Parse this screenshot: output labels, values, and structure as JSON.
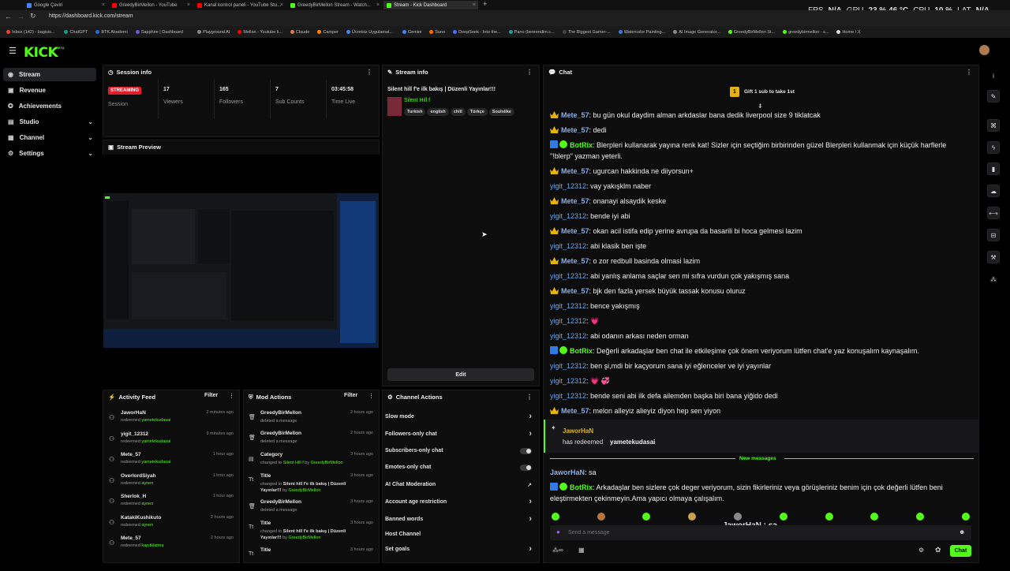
{
  "browser": {
    "tabs": [
      {
        "label": "Google Çeviri",
        "color": "#4285f4"
      },
      {
        "label": "GreedyBirMellon - YouTube",
        "color": "#ff0000"
      },
      {
        "label": "Kanal kontrol paneli - YouTube Stu...",
        "color": "#ff0000"
      },
      {
        "label": "GreedyBirMellon Stream - Watch...",
        "color": "#53fc18"
      },
      {
        "label": "Stream - Kick Dashboard",
        "color": "#53fc18"
      }
    ],
    "new_tab": "+",
    "url": "https://dashboard.kick.com/stream",
    "bookmarks": [
      "Inbox (142) - bagisis...",
      "ChatGPT",
      "BTK Akademi",
      "Sapphire | Dashboard",
      "Playground AI",
      "Mellon - Youtube li...",
      "Claude",
      "Camper",
      "Ücretsiz Uygulamal...",
      "Gemini",
      "Suno",
      "DeepSeek - Into the...",
      "Pano (benrendim.c...",
      "The Biggest Gamer-...",
      "Watercolor Painting...",
      "AI Image Generator...",
      "GreedyBirMellon St...",
      "greedybirmellon - s...",
      "Home / X"
    ]
  },
  "perf": {
    "fps_label": "FPS",
    "fps": "N/A",
    "gpu_label": "GPU",
    "gpu": "23 % 46 °C",
    "cpu_label": "CPU",
    "cpu": "10 %",
    "lat_label": "LAT",
    "lat": "N/A"
  },
  "logo": "KICK",
  "logo_badge": "BETA",
  "sidebar": {
    "items": [
      {
        "label": "Stream",
        "icon": "stream-icon",
        "active": true
      },
      {
        "label": "Revenue",
        "icon": "revenue-icon"
      },
      {
        "label": "Achievements",
        "icon": "achievements-icon"
      },
      {
        "label": "Studio",
        "icon": "studio-icon",
        "chev": "⌄"
      },
      {
        "label": "Channel",
        "icon": "channel-icon",
        "chev": "⌄"
      },
      {
        "label": "Settings",
        "icon": "gear-icon",
        "chev": "⌄"
      }
    ]
  },
  "session": {
    "title": "Session info",
    "badge": "STREAMING",
    "badge_label": "Session",
    "stats": [
      {
        "v": "17",
        "k": "Viewers"
      },
      {
        "v": "165",
        "k": "Followers"
      },
      {
        "v": "7",
        "k": "Sub Counts"
      },
      {
        "v": "03:45:58",
        "k": "Time Live"
      }
    ]
  },
  "preview": {
    "title": "Stream Preview"
  },
  "streaminfo": {
    "title": "Stream info",
    "stream_title": "Silent hill f'e ilk bakış | Düzenli Yayınlar!!!",
    "category": "Silent Hill f",
    "tags": [
      "Turkish",
      "english",
      "chill",
      "Türkçe",
      "Soulslike"
    ],
    "edit": "Edit"
  },
  "activity": {
    "title": "Activity Feed",
    "filter": "Filter",
    "items": [
      {
        "n": "JaworHaN",
        "s": "redeemed",
        "g": "yametekudasai",
        "t": "2 minutes ago"
      },
      {
        "n": "yigit_12312",
        "s": "redeemed",
        "g": "yametekudasai",
        "t": "9 minutes ago"
      },
      {
        "n": "Mete_57",
        "s": "redeemed",
        "g": "yametekudasai",
        "t": "1 hour ago"
      },
      {
        "n": "OverlordSiyah",
        "s": "redeemed",
        "g": "aynen",
        "t": "1 hour ago"
      },
      {
        "n": "Sherlok_H",
        "s": "redeemed",
        "g": "aynen",
        "t": "1 hour ago"
      },
      {
        "n": "KatakiKushikuto",
        "s": "redeemed",
        "g": "aynen",
        "t": "2 hours ago"
      },
      {
        "n": "Mete_57",
        "s": "redeemed",
        "g": "kapıtklatma",
        "t": "2 hours ago"
      }
    ]
  },
  "mod": {
    "title": "Mod Actions",
    "filter": "Filter",
    "items": [
      {
        "n": "GreedyBirMellon",
        "s": "deleted a message",
        "t": "2 hours ago"
      },
      {
        "n": "GreedyBirMellon",
        "s": "deleted a message",
        "t": "2 hours ago"
      },
      {
        "n": "Category",
        "s": "changed to",
        "g": "Silent Hill f",
        "s2": "by",
        "g2": "GreedyBirMellon",
        "t": "3 hours ago"
      },
      {
        "n": "Title",
        "s": "changed to",
        "w": "Silent hill f'e ilk bakış | Düzenli Yayınlar!!!",
        "s2": "by",
        "g2": "GreedyBirMellon",
        "t": "3 hours ago"
      },
      {
        "n": "GreedyBirMellon",
        "s": "deleted a message",
        "t": "3 hours ago"
      },
      {
        "n": "Title",
        "s": "changed to",
        "w": "Silent hill f'e ilk bakış | Düzenli Yayınlar!!!",
        "s2": "by",
        "g2": "GreedyBirMellon",
        "t": "3 hours ago"
      },
      {
        "n": "Title",
        "s": "",
        "t": "3 hours ago"
      }
    ]
  },
  "channel": {
    "title": "Channel Actions",
    "items": [
      {
        "label": "Slow mode",
        "ctrl": "chev"
      },
      {
        "label": "Followers-only chat",
        "ctrl": "chev"
      },
      {
        "label": "Subscribers-only chat",
        "ctrl": "toggle"
      },
      {
        "label": "Emotes-only chat",
        "ctrl": "toggle"
      },
      {
        "label": "AI Chat Moderation",
        "ctrl": "ext"
      },
      {
        "label": "Account age restriction",
        "ctrl": "chev"
      },
      {
        "label": "Banned words",
        "ctrl": "chev"
      },
      {
        "label": "Host Channel",
        "ctrl": ""
      },
      {
        "label": "Set goals",
        "ctrl": "chev"
      }
    ]
  },
  "chat": {
    "title": "Chat",
    "gift": "Gift 1 sub to take 1st",
    "gift_rank": "1",
    "messages": [
      {
        "u": "Mete_57",
        "cls": "u1",
        "b": "crown",
        "m": "bu gün okul daydim alman arkdaslar bana dedik liverpool size 9 tiklatcak"
      },
      {
        "u": "Mete_57",
        "cls": "u1",
        "b": "crown",
        "m": "dedi"
      },
      {
        "u": "BotRix",
        "cls": "u3",
        "b": "bot",
        "m": "Blerpleri kullanarak yayına renk kat! Sizler için seçtiğim birbirinden güzel Blerpleri kullanmak için küçük harflerle \"!blerp\" yazman yeterli."
      },
      {
        "u": "Mete_57",
        "cls": "u1",
        "b": "crown",
        "m": "ugurcan hakkinda ne diiyorsun+"
      },
      {
        "u": "yigit_12312",
        "cls": "u2",
        "b": "",
        "m": "vay yakışklm naber"
      },
      {
        "u": "Mete_57",
        "cls": "u1",
        "b": "crown",
        "m": "onanayi alsaydik keske"
      },
      {
        "u": "yigit_12312",
        "cls": "u2",
        "b": "",
        "m": "bende iyi abi"
      },
      {
        "u": "Mete_57",
        "cls": "u1",
        "b": "crown",
        "m": "okan acil istifa edip yerine avrupa da basarili bi hoca gelmesi lazim"
      },
      {
        "u": "yigit_12312",
        "cls": "u2",
        "b": "",
        "m": "abi klasik ben işte"
      },
      {
        "u": "Mete_57",
        "cls": "u1",
        "b": "crown",
        "m": "o zor redbull basinda olmasi lazim"
      },
      {
        "u": "yigit_12312",
        "cls": "u2",
        "b": "",
        "m": "abi yanlış anlama saçlar sen mi sıfra vurdun çok yakışmış sana"
      },
      {
        "u": "Mete_57",
        "cls": "u1",
        "b": "crown",
        "m": "bjk den fazla yersek büyük tassak konusu oluruz"
      },
      {
        "u": "yigit_12312",
        "cls": "u2",
        "b": "",
        "m": "bence yakışmış"
      },
      {
        "u": "yigit_12312",
        "cls": "u2",
        "b": "",
        "m": "💗"
      },
      {
        "u": "yigit_12312",
        "cls": "u2",
        "b": "",
        "m": "abi odanın arkası neden orman"
      },
      {
        "u": "BotRix",
        "cls": "u3",
        "b": "bot",
        "m": "Değerli arkadaşlar ben chat ile etkileşime çok önem veriyorum lütfen chat'e yaz konuşalım kaynaşalım."
      },
      {
        "u": "yigit_12312",
        "cls": "u2",
        "b": "",
        "m": "ben şi,mdi bir kaçyorum sana iyi eğlenceler ve iyi yayınlar"
      },
      {
        "u": "yigit_12312",
        "cls": "u2",
        "b": "",
        "m": "💗 💞"
      },
      {
        "u": "yigit_12312",
        "cls": "u2",
        "b": "",
        "m": "bende seni abi ilk defa ailemden başka biri bana yiğido dedi"
      },
      {
        "u": "Mete_57",
        "cls": "u1",
        "b": "crown",
        "m": "melon alleyiz alieyiz diyon hep sen yiyon"
      }
    ],
    "redeem": {
      "user": "JaworHaN",
      "text": "has redeemed",
      "gift": "yametekudasai"
    },
    "new_messages": "New messages",
    "after": [
      {
        "u": "JaworHaN",
        "cls": "u1",
        "b": "",
        "m": "sa"
      },
      {
        "u": "BotRix",
        "cls": "u3",
        "b": "bot",
        "m": "Arkadaşlar ben sizlere çok deger veriyorum, sizin fikirleriniz veya görüşleriniz benim için çok değerli lütfen beni eleştirmekten çekinmeyin.Ama yapıcı olmaya çalışalım."
      }
    ],
    "overlay": "JaworHaN : sa",
    "placeholder": "Send a message",
    "send": "Chat"
  }
}
